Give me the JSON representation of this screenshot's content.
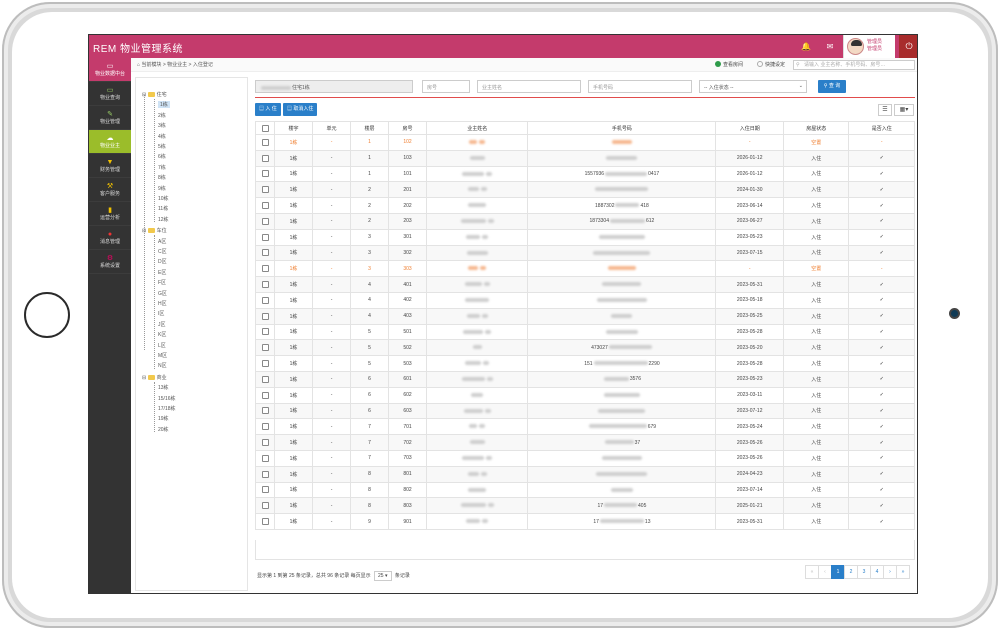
{
  "app": {
    "title": "REM 物业管理系统",
    "user_name": "管理员",
    "user_role": "管理员"
  },
  "sidebar": {
    "top_label": "物业数据中台",
    "items": [
      {
        "label": "物业查询",
        "icon": "monitor-icon"
      },
      {
        "label": "物业管理",
        "icon": "edit-icon"
      },
      {
        "label": "物业业主",
        "icon": "cloud-icon",
        "active": true
      },
      {
        "label": "财务管理",
        "icon": "funnel-icon"
      },
      {
        "label": "客户服务",
        "icon": "tools-icon"
      },
      {
        "label": "运营分析",
        "icon": "bar-chart-icon"
      },
      {
        "label": "消息管理",
        "icon": "chat-icon"
      },
      {
        "label": "系统设置",
        "icon": "gears-icon"
      }
    ]
  },
  "breadcrumb": {
    "home": "当前模块",
    "path": "物业业主 > 入住登记"
  },
  "legend": {
    "checked": "查看房间",
    "pending": "快捷设定"
  },
  "top_search_placeholder": "请输入 业主名称、手机号码、房号…",
  "tree": {
    "groups": [
      {
        "label": "住宅",
        "children": [
          "1栋",
          "2栋",
          "3栋",
          "4栋",
          "5栋",
          "6栋",
          "7栋",
          "8栋",
          "9栋",
          "10栋",
          "11栋",
          "12栋"
        ]
      },
      {
        "label": "车位",
        "children": [
          "A区",
          "C区",
          "D区",
          "E区",
          "F区",
          "G区",
          "H区",
          "I区",
          "J区",
          "K区",
          "L区",
          "M区",
          "N区"
        ]
      },
      {
        "label": "商业",
        "children": [
          "13栋",
          "15/16栋",
          "17/18栋",
          "19栋",
          "20栋"
        ]
      }
    ]
  },
  "filters": {
    "building_value": "住宅1栋",
    "room_placeholder": "房号",
    "owner_placeholder": "业主姓名",
    "phone_placeholder": "手机号码",
    "status_placeholder": "-- 入住状态 --",
    "query_label": "查 询"
  },
  "actions": {
    "checkin_label": "入 住",
    "cancel_label": "取消入住"
  },
  "table": {
    "headers": [
      "楼宇",
      "单元",
      "楼层",
      "房号",
      "业主姓名",
      "手机号码",
      "入住日期",
      "房屋状态",
      "是否入住"
    ],
    "rows": [
      {
        "building": "1栋",
        "unit": "-",
        "floor": "1",
        "room": "102",
        "date": "-",
        "status": "空置",
        "in": "-",
        "vacant": true
      },
      {
        "building": "1栋",
        "unit": "-",
        "floor": "1",
        "room": "103",
        "date": "2026-01-12",
        "status": "入住",
        "in": "✓"
      },
      {
        "building": "1栋",
        "unit": "-",
        "floor": "1",
        "room": "101",
        "phone_mid": "1557936",
        "phone_tail": "0417",
        "date": "2026-01-12",
        "status": "入住",
        "in": "✓"
      },
      {
        "building": "1栋",
        "unit": "-",
        "floor": "2",
        "room": "201",
        "date": "2024-01-30",
        "status": "入住",
        "in": "✓"
      },
      {
        "building": "1栋",
        "unit": "-",
        "floor": "2",
        "room": "202",
        "phone_mid": "1887302",
        "phone_tail": "418",
        "date": "2023-06-14",
        "status": "入住",
        "in": "✓"
      },
      {
        "building": "1栋",
        "unit": "-",
        "floor": "2",
        "room": "203",
        "phone_mid": "1873304",
        "phone_tail": "612",
        "date": "2023-06-27",
        "status": "入住",
        "in": "✓"
      },
      {
        "building": "1栋",
        "unit": "-",
        "floor": "3",
        "room": "301",
        "date": "2023-05-23",
        "status": "入住",
        "in": "✓"
      },
      {
        "building": "1栋",
        "unit": "-",
        "floor": "3",
        "room": "302",
        "date": "2023-07-15",
        "status": "入住",
        "in": "✓"
      },
      {
        "building": "1栋",
        "unit": "-",
        "floor": "3",
        "room": "303",
        "date": "-",
        "status": "空置",
        "in": "-",
        "vacant": true
      },
      {
        "building": "1栋",
        "unit": "-",
        "floor": "4",
        "room": "401",
        "date": "2023-05-31",
        "status": "入住",
        "in": "✓"
      },
      {
        "building": "1栋",
        "unit": "-",
        "floor": "4",
        "room": "402",
        "date": "2023-05-18",
        "status": "入住",
        "in": "✓"
      },
      {
        "building": "1栋",
        "unit": "-",
        "floor": "4",
        "room": "403",
        "date": "2023-05-25",
        "status": "入住",
        "in": "✓"
      },
      {
        "building": "1栋",
        "unit": "-",
        "floor": "5",
        "room": "501",
        "date": "2023-05-28",
        "status": "入住",
        "in": "✓"
      },
      {
        "building": "1栋",
        "unit": "-",
        "floor": "5",
        "room": "502",
        "phone_mid": "473027",
        "date": "2023-05-20",
        "status": "入住",
        "in": "✓"
      },
      {
        "building": "1栋",
        "unit": "-",
        "floor": "5",
        "room": "503",
        "phone_mid": "151",
        "phone_tail": "2290",
        "date": "2023-05-28",
        "status": "入住",
        "in": "✓"
      },
      {
        "building": "1栋",
        "unit": "-",
        "floor": "6",
        "room": "601",
        "phone_tail": "3576",
        "date": "2023-05-23",
        "status": "入住",
        "in": "✓"
      },
      {
        "building": "1栋",
        "unit": "-",
        "floor": "6",
        "room": "602",
        "date": "2023-03-11",
        "status": "入住",
        "in": "✓"
      },
      {
        "building": "1栋",
        "unit": "-",
        "floor": "6",
        "room": "603",
        "date": "2023-07-12",
        "status": "入住",
        "in": "✓"
      },
      {
        "building": "1栋",
        "unit": "-",
        "floor": "7",
        "room": "701",
        "phone_tail": "679",
        "date": "2023-05-24",
        "status": "入住",
        "in": "✓"
      },
      {
        "building": "1栋",
        "unit": "-",
        "floor": "7",
        "room": "702",
        "phone_tail": "37",
        "date": "2023-05-26",
        "status": "入住",
        "in": "✓"
      },
      {
        "building": "1栋",
        "unit": "-",
        "floor": "7",
        "room": "703",
        "date": "2023-05-26",
        "status": "入住",
        "in": "✓"
      },
      {
        "building": "1栋",
        "unit": "-",
        "floor": "8",
        "room": "801",
        "date": "2024-04-23",
        "status": "入住",
        "in": "✓"
      },
      {
        "building": "1栋",
        "unit": "-",
        "floor": "8",
        "room": "802",
        "date": "2023-07-14",
        "status": "入住",
        "in": "✓"
      },
      {
        "building": "1栋",
        "unit": "-",
        "floor": "8",
        "room": "803",
        "phone_mid": "17",
        "phone_tail": "405",
        "date": "2025-01-21",
        "status": "入住",
        "in": "✓"
      },
      {
        "building": "1栋",
        "unit": "-",
        "floor": "9",
        "room": "901",
        "phone_mid": "17",
        "phone_tail": "13",
        "date": "2023-05-31",
        "status": "入住",
        "in": "✓"
      }
    ]
  },
  "pagination": {
    "summary_prefix": "显示第 1 到第 25 条记录，总共 96 条记录  每页显示",
    "page_size": "25",
    "summary_suffix": "条记录",
    "pages": [
      "«",
      "‹",
      "1",
      "2",
      "3",
      "4",
      "›",
      "»"
    ],
    "current": "1"
  },
  "colors": {
    "topbar": "#c43b6c",
    "accent": "#2a7fc9",
    "active_side": "#9bbd2a",
    "vacant": "#ef7e2f"
  }
}
